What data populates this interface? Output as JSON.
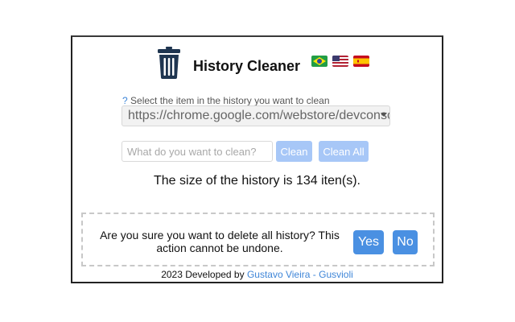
{
  "app": {
    "title": "History Cleaner",
    "logo_icon": "trash-can-icon",
    "languages": [
      {
        "name": "brazil-flag-icon"
      },
      {
        "name": "usa-flag-icon"
      },
      {
        "name": "spain-flag-icon"
      }
    ]
  },
  "selector": {
    "hint_prefix": "?",
    "hint": "Select the item in the history you want to clean",
    "selected_value": "https://chrome.google.com/webstore/devconsole"
  },
  "filter": {
    "placeholder": "What do you want to clean?",
    "value": "",
    "clean_label": "Clean",
    "clean_all_label": "Clean All"
  },
  "status": {
    "size_text": "The size of the history is 134 iten(s)."
  },
  "confirm": {
    "message": "Are you sure you want to delete all history? This action cannot be undone.",
    "yes_label": "Yes",
    "no_label": "No"
  },
  "footer": {
    "text": "2023 Developed by",
    "author_link": "Gustavo Vieira - Gusvioli"
  },
  "colors": {
    "accent": "#4a90e2",
    "accent_light": "#a7c7f7",
    "link": "#3f86d8"
  }
}
